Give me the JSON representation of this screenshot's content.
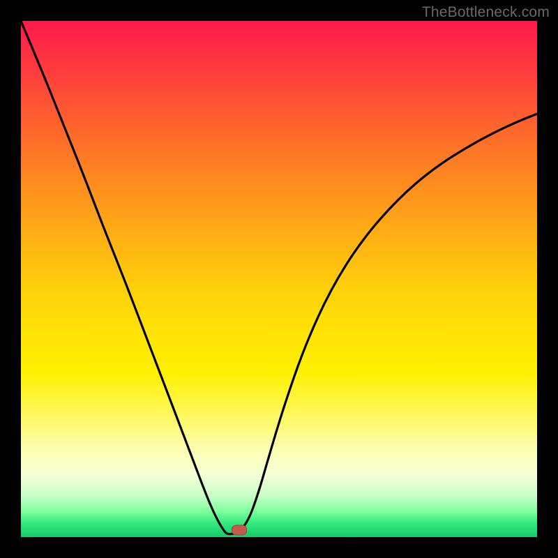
{
  "watermark": "TheBottleneck.com",
  "marker": {
    "x_frac": 0.423,
    "y_frac": 0.986
  },
  "chart_data": {
    "type": "line",
    "title": "",
    "xlabel": "",
    "ylabel": "",
    "xlim": [
      0,
      1
    ],
    "ylim": [
      0,
      1
    ],
    "series": [
      {
        "name": "bottleneck-curve",
        "x": [
          0.0,
          0.04,
          0.08,
          0.12,
          0.16,
          0.2,
          0.24,
          0.28,
          0.32,
          0.35,
          0.37,
          0.385,
          0.395,
          0.4,
          0.41,
          0.42,
          0.44,
          0.46,
          0.48,
          0.51,
          0.55,
          0.6,
          0.66,
          0.73,
          0.8,
          0.88,
          0.95,
          1.0
        ],
        "y": [
          1.0,
          0.905,
          0.805,
          0.705,
          0.6,
          0.5,
          0.395,
          0.29,
          0.185,
          0.105,
          0.055,
          0.025,
          0.01,
          0.006,
          0.006,
          0.008,
          0.03,
          0.085,
          0.155,
          0.255,
          0.37,
          0.48,
          0.575,
          0.655,
          0.715,
          0.765,
          0.8,
          0.82
        ]
      }
    ],
    "gradient_stops": [
      {
        "pos": 0.0,
        "color": "#ff1a4b"
      },
      {
        "pos": 0.3,
        "color": "#ff8e1f"
      },
      {
        "pos": 0.6,
        "color": "#ffe205"
      },
      {
        "pos": 0.85,
        "color": "#fcffb0"
      },
      {
        "pos": 1.0,
        "color": "#17c96a"
      }
    ],
    "marker": {
      "x": 0.423,
      "y": 0.014
    }
  }
}
